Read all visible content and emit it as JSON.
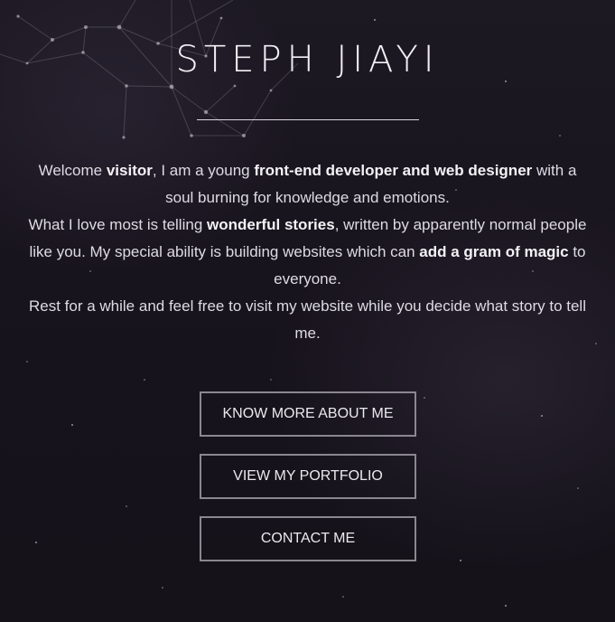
{
  "header": {
    "title": "STEPH JIAYI"
  },
  "intro": {
    "p1_a": "Welcome ",
    "p1_b": "visitor",
    "p1_c": ", I am a young ",
    "p1_d": "front-end developer and web designer",
    "p1_e": " with a soul burning for knowledge and emotions.",
    "p2_a": "What I love most is telling ",
    "p2_b": "wonderful stories",
    "p2_c": ", written by apparently normal people like you. My special ability is building websites which can ",
    "p2_d": "add a gram of magic",
    "p2_e": " to everyone.",
    "p3": "Rest for a while and feel free to visit my website while you decide what story to tell me."
  },
  "buttons": {
    "about": "KNOW MORE ABOUT ME",
    "portfolio": "VIEW MY PORTFOLIO",
    "contact": "CONTACT ME"
  },
  "colors": {
    "background": "#1a1620",
    "text": "#e8e6ec",
    "button_border": "#8b8790"
  }
}
